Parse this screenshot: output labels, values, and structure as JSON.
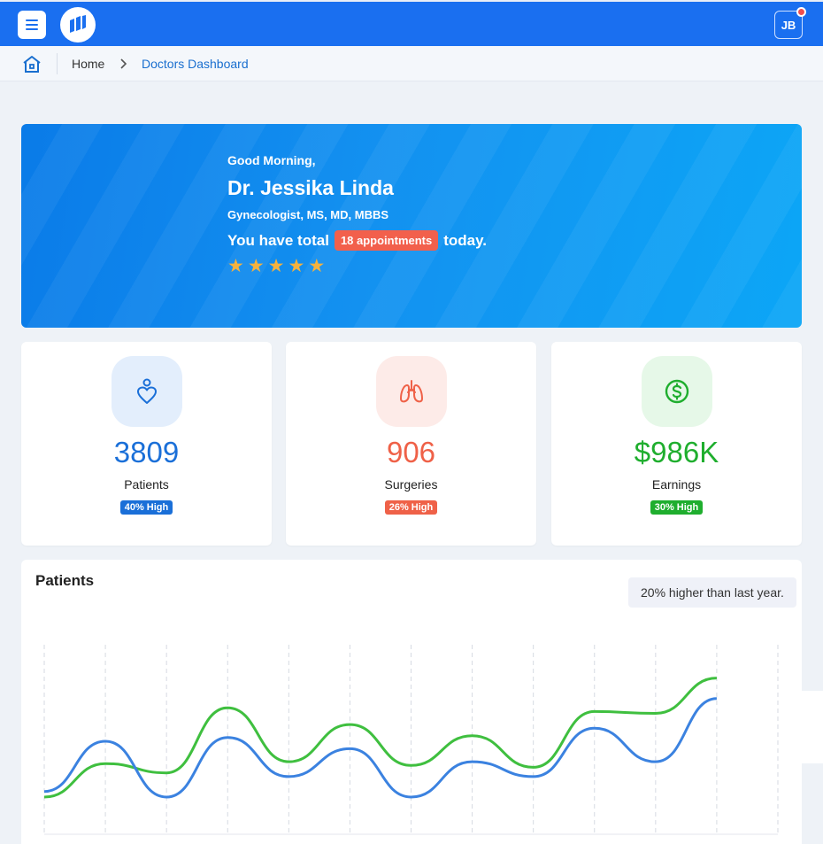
{
  "header": {
    "menu_icon": "hamburger-icon",
    "logo_icon": "hospital-logo-icon",
    "avatar_initials": "JB"
  },
  "breadcrumb": {
    "home_icon": "home-icon",
    "items": [
      "Home",
      "Doctors Dashboard"
    ]
  },
  "hero": {
    "greeting": "Good Morning,",
    "name": "Dr. Jessika Linda",
    "specialty": "Gynecologist, MS, MD, MBBS",
    "appointments_prefix": "You have total",
    "appointments_badge": "18 appointments",
    "appointments_suffix": "today.",
    "rating": 5
  },
  "stats": [
    {
      "icon": "heart-person-icon",
      "value": "3809",
      "label": "Patients",
      "badge": "40% High",
      "color": "#1a6fd8",
      "bg": "#e3eefc",
      "badge_color": "#1a6fd8"
    },
    {
      "icon": "lungs-icon",
      "value": "906",
      "label": "Surgeries",
      "badge": "26% High",
      "color": "#ef6148",
      "bg": "#fdebe8",
      "badge_color": "#ef6148"
    },
    {
      "icon": "dollar-circle-icon",
      "value": "$986K",
      "label": "Earnings",
      "badge": "30% High",
      "color": "#1fae2e",
      "bg": "#e6f8e8",
      "badge_color": "#1fae2e"
    }
  ],
  "patients_chart": {
    "title": "Patients",
    "note": "20% higher than last year."
  },
  "chart_data": {
    "type": "line",
    "x": [
      0,
      1,
      2,
      3,
      4,
      5,
      6,
      7,
      8,
      9,
      10,
      11,
      12
    ],
    "series": [
      {
        "color": "#3b82e0",
        "values": [
          23,
          50,
          20,
          52,
          31,
          46,
          20,
          39,
          31,
          57,
          39,
          73
        ]
      },
      {
        "color": "#3fbf3f",
        "values": [
          20,
          38,
          33,
          68,
          39,
          59,
          37,
          53,
          36,
          66,
          65,
          84
        ]
      }
    ],
    "ylim": [
      0,
      100
    ],
    "grid": "vertical dashed"
  }
}
